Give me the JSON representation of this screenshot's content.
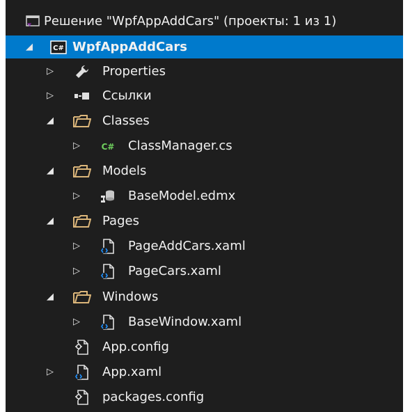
{
  "solution": {
    "label": "Решение \"WpfAppAddCars\" (проекты: 1 из 1)"
  },
  "project": {
    "label": "WpfAppAddCars",
    "icon": "csharp-project-icon",
    "selected_color": "#007acc"
  },
  "items": {
    "properties": {
      "label": "Properties",
      "icon": "wrench-icon"
    },
    "references": {
      "label": "Ссылки",
      "icon": "references-icon"
    },
    "classes": {
      "label": "Classes",
      "icon": "folder-icon"
    },
    "class_manager": {
      "label": "ClassManager.cs",
      "icon": "csharp-file-icon"
    },
    "models": {
      "label": "Models",
      "icon": "folder-icon"
    },
    "base_model": {
      "label": "BaseModel.edmx",
      "icon": "edmx-file-icon"
    },
    "pages": {
      "label": "Pages",
      "icon": "folder-icon"
    },
    "page_add_cars": {
      "label": "PageAddCars.xaml",
      "icon": "xaml-file-icon"
    },
    "page_cars": {
      "label": "PageCars.xaml",
      "icon": "xaml-file-icon"
    },
    "windows": {
      "label": "Windows",
      "icon": "folder-icon"
    },
    "base_window": {
      "label": "BaseWindow.xaml",
      "icon": "xaml-file-icon"
    },
    "app_config": {
      "label": "App.config",
      "icon": "config-file-icon"
    },
    "app_xaml": {
      "label": "App.xaml",
      "icon": "xaml-file-icon"
    },
    "packages_config": {
      "label": "packages.config",
      "icon": "config-file-icon"
    }
  },
  "colors": {
    "background": "#1e1e1e",
    "text": "#f1f1f1",
    "folder": "#dcb67a",
    "csharp": "#6fcf5e",
    "xaml_accent": "#1e90ff",
    "solution_purple": "#68217a"
  }
}
